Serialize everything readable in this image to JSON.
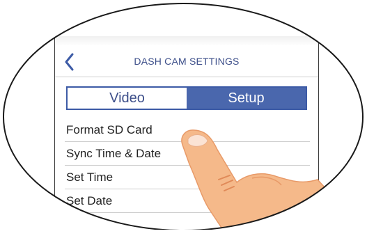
{
  "header": {
    "title": "DASH CAM SETTINGS",
    "back_icon": "chevron-left-icon"
  },
  "tabs": {
    "video_label": "Video",
    "setup_label": "Setup",
    "selected": "Setup"
  },
  "settings_list": [
    {
      "label": "Format SD Card"
    },
    {
      "label": "Sync Time & Date"
    },
    {
      "label": "Set Time"
    },
    {
      "label": "Set Date"
    }
  ],
  "colors": {
    "accent": "#4a67ad",
    "title_text": "#3d4f8a",
    "finger_skin": "#f5b98a"
  }
}
